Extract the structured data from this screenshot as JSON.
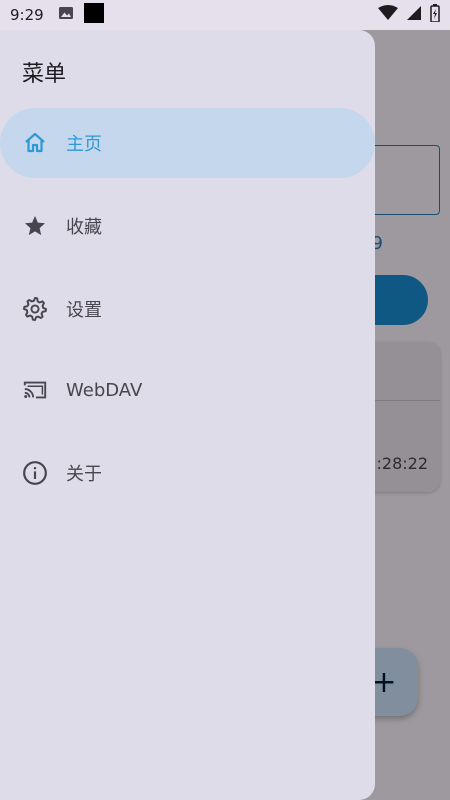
{
  "status_bar": {
    "time": "9:29",
    "left_icons": [
      "image-icon",
      "black-square-icon"
    ],
    "right_icons": [
      "wifi-icon",
      "signal-icon",
      "battery-icon"
    ]
  },
  "background": {
    "count_text": "19",
    "card_time": ":28:22",
    "fab_symbol": "+"
  },
  "drawer": {
    "title": "菜单",
    "items": [
      {
        "label": "主页",
        "icon": "home-icon",
        "active": true
      },
      {
        "label": "收藏",
        "icon": "star-icon",
        "active": false
      },
      {
        "label": "设置",
        "icon": "gear-icon",
        "active": false
      },
      {
        "label": "WebDAV",
        "icon": "cast-icon",
        "active": false
      },
      {
        "label": "关于",
        "icon": "info-icon",
        "active": false
      }
    ]
  },
  "colors": {
    "accent": "#2d9ad8",
    "drawer_bg": "#dedce9",
    "active_bg": "#c4d7ec"
  }
}
